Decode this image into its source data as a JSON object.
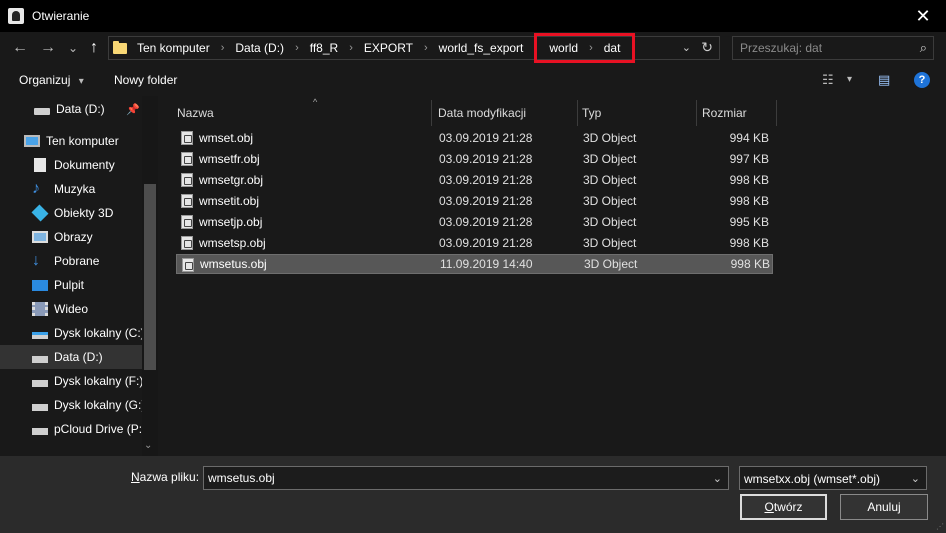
{
  "window": {
    "title": "Otwieranie",
    "close_glyph": "✕"
  },
  "nav": {
    "back_glyph": "←",
    "forward_glyph": "→",
    "recent_glyph": "⌄",
    "up_glyph": "↑",
    "breadcrumbs": [
      "Ten komputer",
      "Data (D:)",
      "ff8_R",
      "EXPORT",
      "world_fs_export"
    ],
    "highlighted_crumbs": [
      "world",
      "dat"
    ],
    "separator_glyph": "›",
    "dropdown_glyph": "⌄",
    "refresh_glyph": "↻",
    "search_placeholder": "Przeszukaj: dat",
    "search_glyph": "⌕",
    "highlight_color": "#e81123"
  },
  "toolbar": {
    "organize_label": "Organizuj",
    "organize_caret": "▾",
    "new_folder_label": "Nowy folder",
    "view_glyph": "☷",
    "view_caret": "▾",
    "pane_glyph": "▤",
    "help_glyph": "?"
  },
  "sidebar": {
    "pin_glyph": "📌",
    "items": [
      {
        "label": "Data (D:)",
        "icon": "drive-icon"
      },
      {
        "label": "Ten komputer",
        "icon": "computer-icon"
      },
      {
        "label": "Dokumenty",
        "icon": "documents-icon"
      },
      {
        "label": "Muzyka",
        "icon": "music-icon"
      },
      {
        "label": "Obiekty 3D",
        "icon": "objects-3d-icon"
      },
      {
        "label": "Obrazy",
        "icon": "pictures-icon"
      },
      {
        "label": "Pobrane",
        "icon": "downloads-icon"
      },
      {
        "label": "Pulpit",
        "icon": "desktop-icon"
      },
      {
        "label": "Wideo",
        "icon": "video-icon"
      },
      {
        "label": "Dysk lokalny (C:)",
        "icon": "system-drive-icon"
      },
      {
        "label": "Data (D:)",
        "icon": "drive-icon"
      },
      {
        "label": "Dysk lokalny (F:)",
        "icon": "drive-icon"
      },
      {
        "label": "Dysk lokalny (G:)",
        "icon": "drive-icon"
      },
      {
        "label": "pCloud Drive (P:)",
        "icon": "drive-icon"
      }
    ],
    "scroll_down_glyph": "⌄"
  },
  "columns": [
    "Nazwa",
    "Data modyfikacji",
    "Typ",
    "Rozmiar"
  ],
  "sort_glyph": "^",
  "files": [
    {
      "name": "wmset.obj",
      "modified": "03.09.2019 21:28",
      "type": "3D Object",
      "size": "994 KB"
    },
    {
      "name": "wmsetfr.obj",
      "modified": "03.09.2019 21:28",
      "type": "3D Object",
      "size": "997 KB"
    },
    {
      "name": "wmsetgr.obj",
      "modified": "03.09.2019 21:28",
      "type": "3D Object",
      "size": "998 KB"
    },
    {
      "name": "wmsetit.obj",
      "modified": "03.09.2019 21:28",
      "type": "3D Object",
      "size": "998 KB"
    },
    {
      "name": "wmsetjp.obj",
      "modified": "03.09.2019 21:28",
      "type": "3D Object",
      "size": "995 KB"
    },
    {
      "name": "wmsetsp.obj",
      "modified": "03.09.2019 21:28",
      "type": "3D Object",
      "size": "998 KB"
    },
    {
      "name": "wmsetus.obj",
      "modified": "11.09.2019 14:40",
      "type": "3D Object",
      "size": "998 KB"
    }
  ],
  "footer": {
    "filename_label_prefix": "N",
    "filename_label_rest": "azwa pliku:",
    "filename_value": "wmsetus.obj",
    "filter_value": "wmsetxx.obj (wmset*.obj)",
    "open_label_first": "O",
    "open_label_rest": "twórz",
    "cancel_label": "Anuluj",
    "dropdown_glyph": "⌄",
    "grip_glyph": "⋰"
  }
}
